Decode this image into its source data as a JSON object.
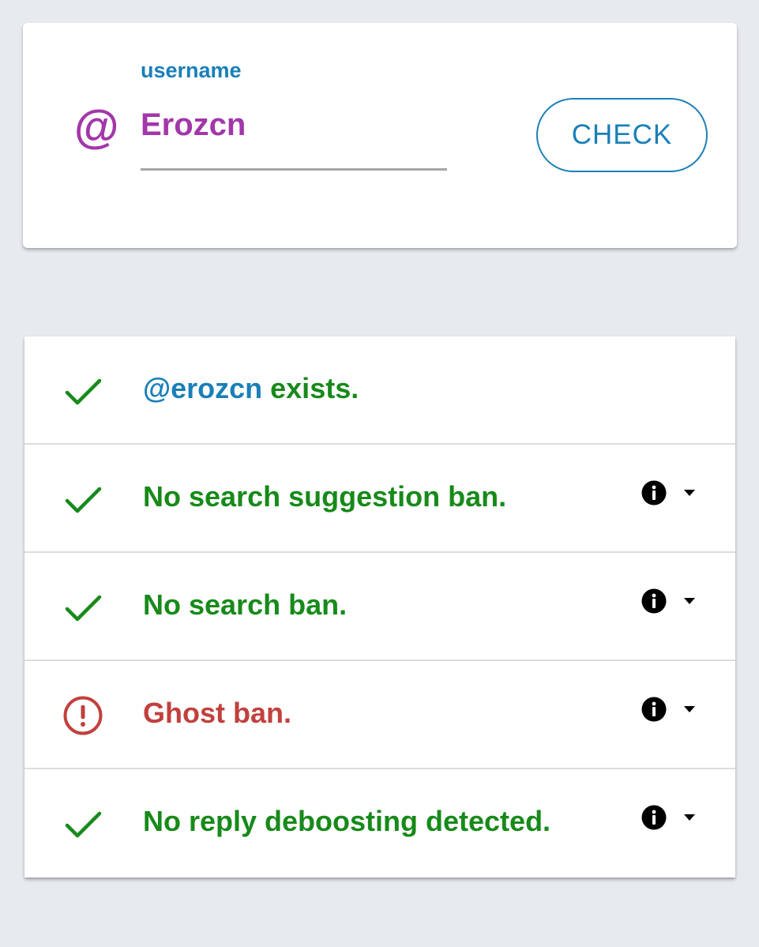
{
  "search": {
    "label": "username",
    "at_symbol": "@",
    "value": "Erozcn",
    "button_label": "CHECK"
  },
  "results": [
    {
      "status": "ok",
      "handle": "@erozcn",
      "text": " exists.",
      "has_info": false
    },
    {
      "status": "ok",
      "text": "No search suggestion ban.",
      "has_info": true
    },
    {
      "status": "ok",
      "text": "No search ban.",
      "has_info": true
    },
    {
      "status": "alert",
      "text": "Ghost ban.",
      "has_info": true
    },
    {
      "status": "ok",
      "text": "No reply deboosting detected.",
      "has_info": true
    }
  ],
  "icons": {
    "ok": "check-icon",
    "alert": "alert-circle-icon",
    "info": "info-icon",
    "expand": "caret-down-icon"
  },
  "colors": {
    "ok": "#178a1a",
    "alert": "#c1403d",
    "handle": "#1a7fb8",
    "accent": "#a237a9"
  }
}
